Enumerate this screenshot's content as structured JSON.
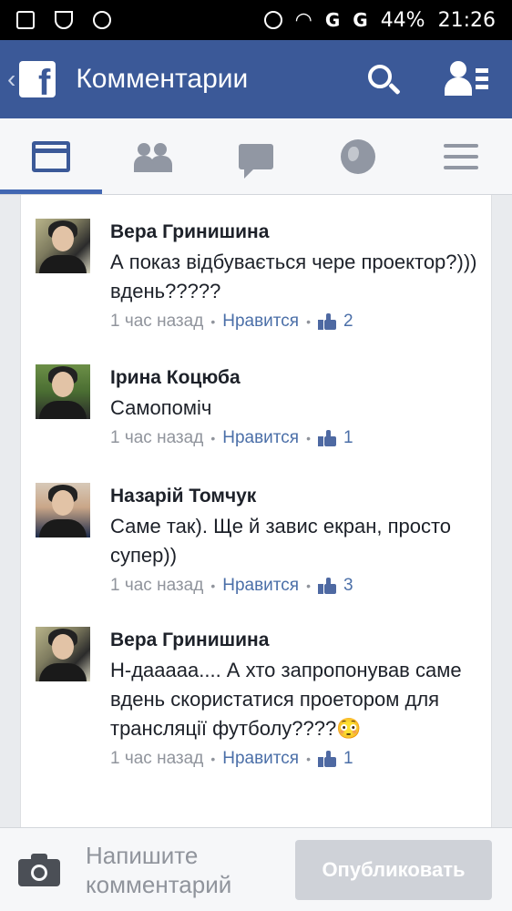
{
  "statusbar": {
    "signal_1": "G",
    "signal_2": "G",
    "battery": "44%",
    "time": "21:26"
  },
  "appbar": {
    "back": "‹",
    "logo_letter": "f",
    "title": "Комментарии"
  },
  "tabs": [
    {
      "name": "feed",
      "icon": "news-feed-icon",
      "active": true
    },
    {
      "name": "friends",
      "icon": "friends-icon",
      "active": false
    },
    {
      "name": "messages",
      "icon": "messages-icon",
      "active": false
    },
    {
      "name": "notifications",
      "icon": "globe-icon",
      "active": false
    },
    {
      "name": "menu",
      "icon": "menu-icon",
      "active": false
    }
  ],
  "comments": [
    {
      "author": "Вера Гринишина",
      "text": "А показ відбувається чере проектор?))) вдень?????",
      "time": "1 час назад",
      "like_label": "Нравится",
      "likes": "2"
    },
    {
      "author": "Ірина Коцюба",
      "text": "Самопоміч",
      "time": "1 час назад",
      "like_label": "Нравится",
      "likes": "1"
    },
    {
      "author": "Назарій Томчук",
      "text": "Саме так). Ще й завис екран, просто супер))",
      "time": "1 час назад",
      "like_label": "Нравится",
      "likes": "3"
    },
    {
      "author": "Вера Гринишина",
      "text": "Н-дааааа.... А хто запропонував саме вдень скористатися проетором для трансляції футболу????😳",
      "time": "1 час назад",
      "like_label": "Нравится",
      "likes": "1"
    }
  ],
  "composer": {
    "placeholder": "Напишите комментарий",
    "publish_label": "Опубликовать"
  },
  "colors": {
    "brand": "#3b5998",
    "link": "#4b6fa8",
    "meta": "#90949c"
  }
}
